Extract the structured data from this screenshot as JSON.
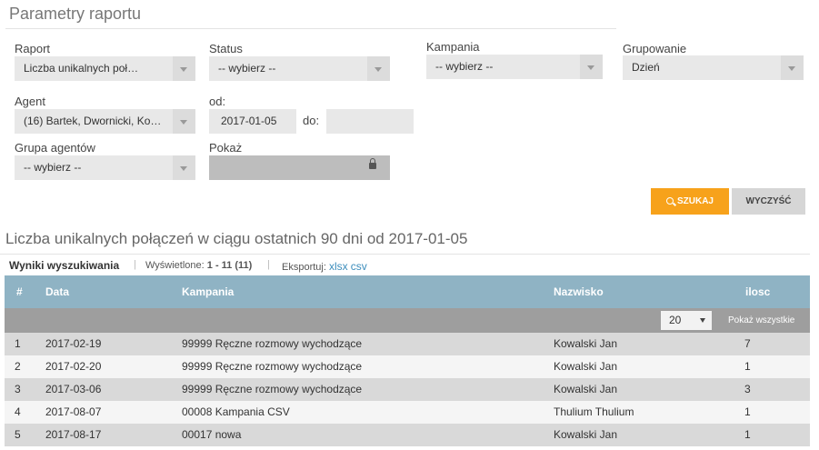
{
  "params": {
    "title": "Parametry raportu",
    "raport": {
      "label": "Raport",
      "value": "Liczba unikalnych poł…"
    },
    "status": {
      "label": "Status",
      "value": "-- wybierz --"
    },
    "kampania": {
      "label": "Kampania",
      "value": "-- wybierz --"
    },
    "grupowanie": {
      "label": "Grupowanie",
      "value": "Dzień"
    },
    "agent": {
      "label": "Agent",
      "value": "(16) Bartek, Dwornicki, Ko…"
    },
    "od": {
      "label": "od:",
      "value": "2017-01-05"
    },
    "do": {
      "label": "do:",
      "value": ""
    },
    "grupa_agentow": {
      "label": "Grupa agentów",
      "value": "-- wybierz --"
    },
    "pokaz": {
      "label": "Pokaż",
      "value": ""
    },
    "search_label": "SZUKAJ",
    "clear_label": "WYCZYŚĆ"
  },
  "results": {
    "title": "Liczba unikalnych połączeń w ciągu ostatnich 90 dni od 2017-01-05",
    "tab_label": "Wyniki wyszukiwania",
    "shown_label": "Wyświetlone:",
    "shown_value": "1 - 11 (11)",
    "export_label": "Eksportuj:",
    "export_xlsx": "xlsx",
    "export_csv": "csv",
    "columns": [
      "#",
      "Data",
      "Kampania",
      "Nazwisko",
      "ilosc"
    ],
    "page_size": "20",
    "show_all_label": "Pokaż wszystkie",
    "rows": [
      [
        "1",
        "2017-02-19",
        "99999 Ręczne rozmowy wychodzące",
        "Kowalski Jan",
        "7"
      ],
      [
        "2",
        "2017-02-20",
        "99999 Ręczne rozmowy wychodzące",
        "Kowalski Jan",
        "1"
      ],
      [
        "3",
        "2017-03-06",
        "99999 Ręczne rozmowy wychodzące",
        "Kowalski Jan",
        "3"
      ],
      [
        "4",
        "2017-08-07",
        "00008 Kampania CSV",
        "Thulium Thulium",
        "1"
      ],
      [
        "5",
        "2017-08-17",
        "00017 nowa",
        "Kowalski Jan",
        "1"
      ]
    ]
  }
}
